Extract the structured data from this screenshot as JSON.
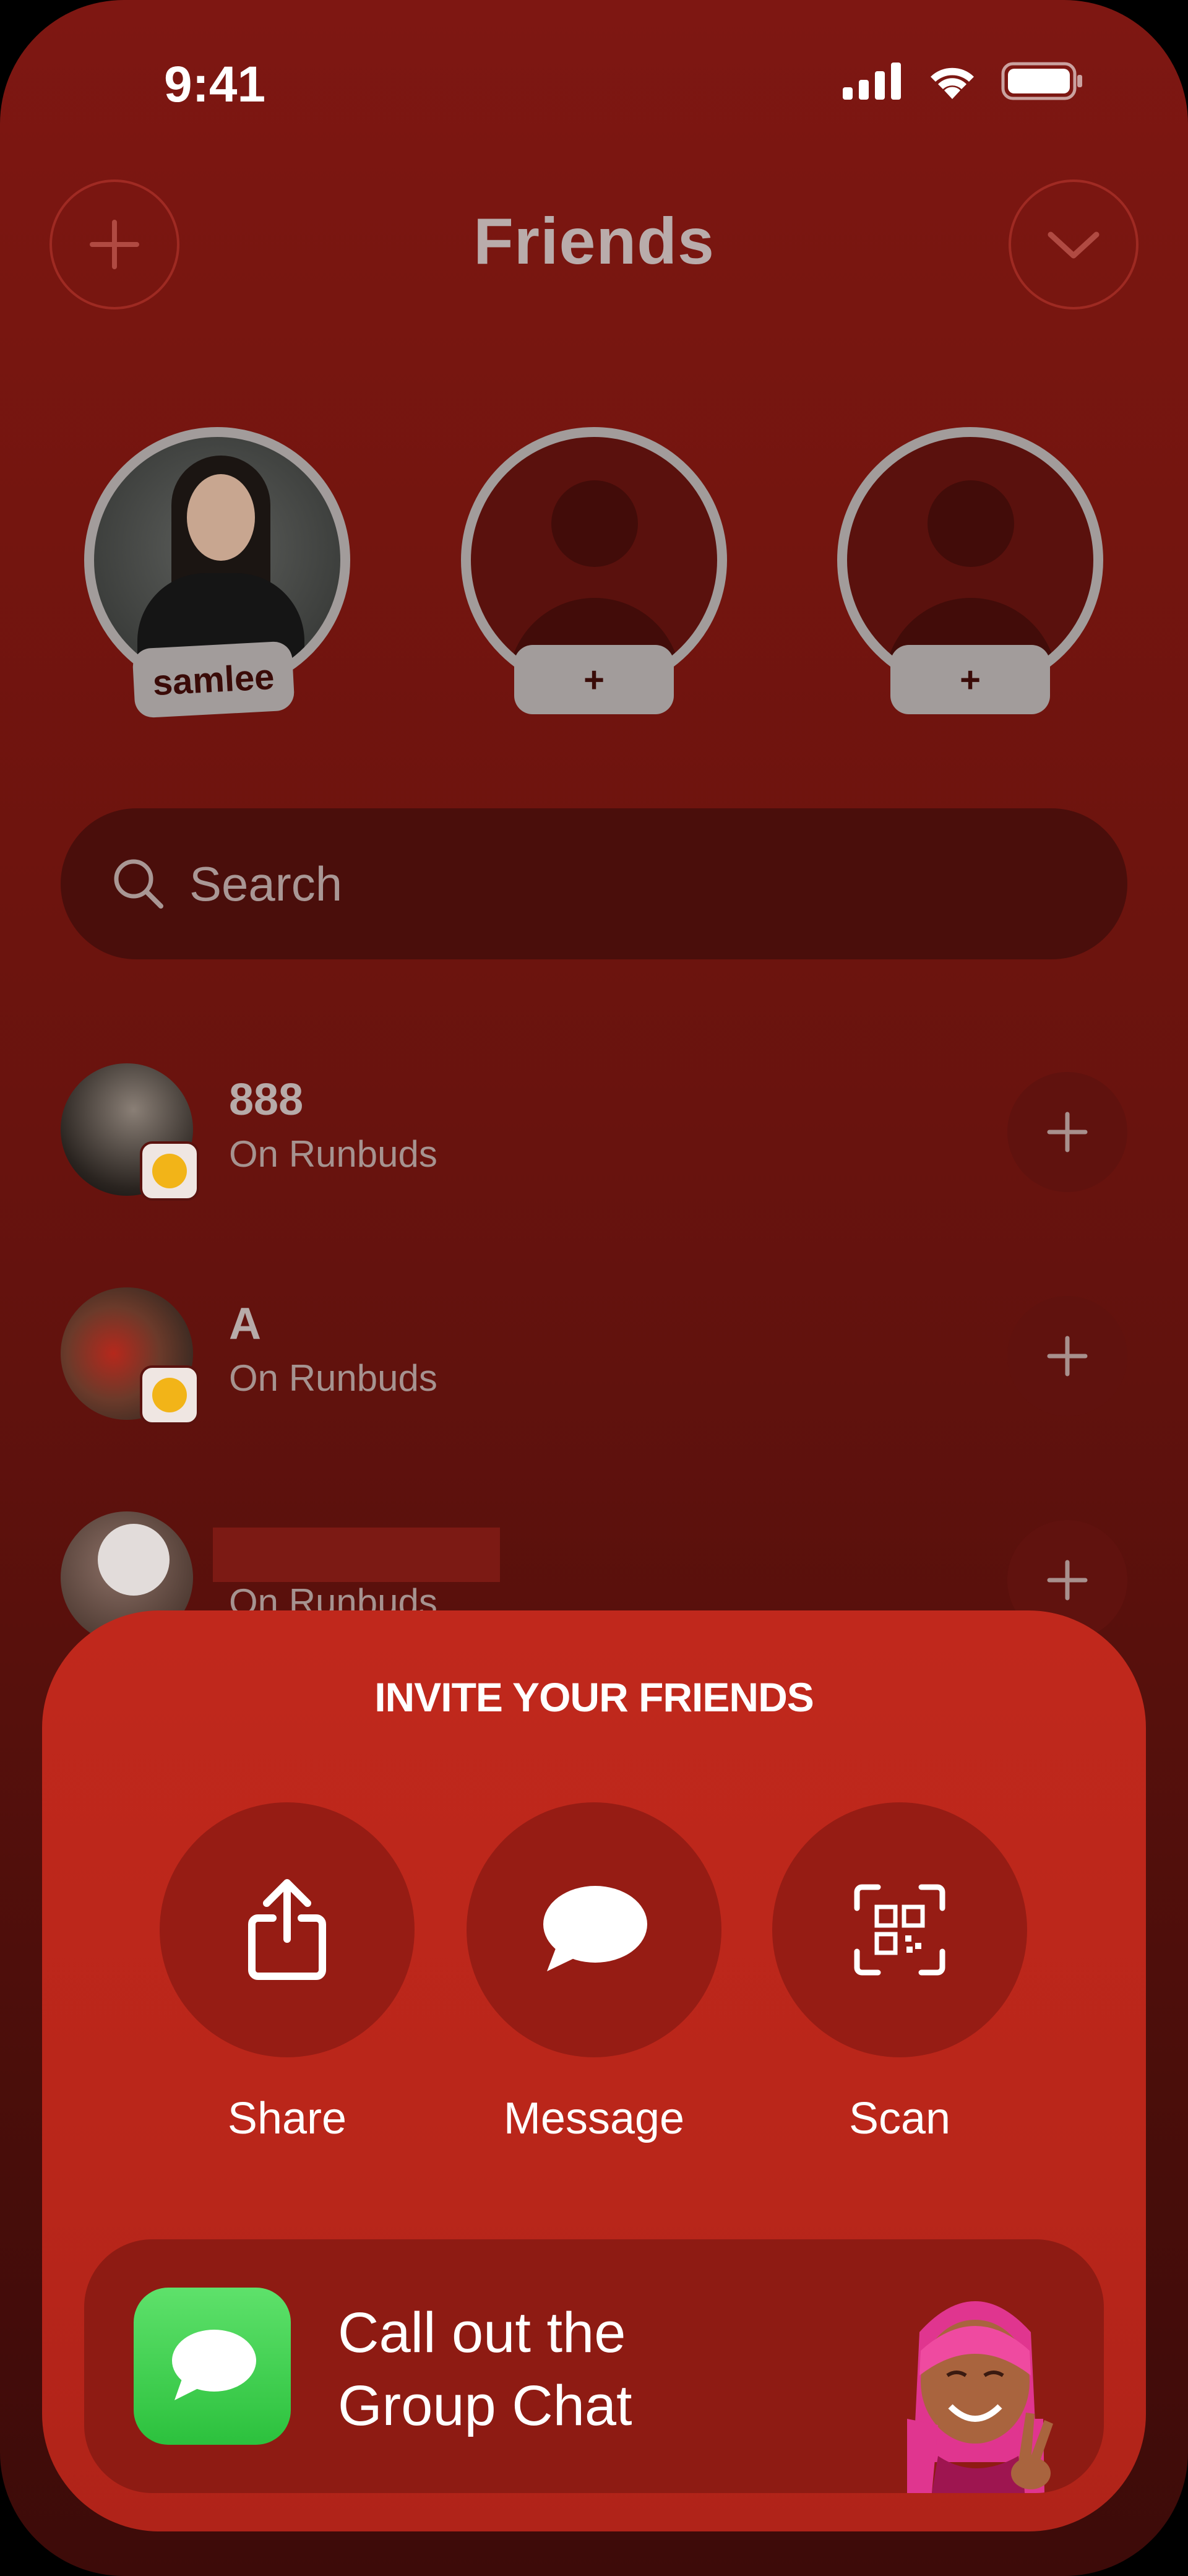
{
  "status_bar": {
    "time": "9:41"
  },
  "header": {
    "title": "Friends"
  },
  "stories": [
    {
      "label": "samlee"
    },
    {
      "label": "+"
    },
    {
      "label": "+"
    }
  ],
  "search": {
    "placeholder": "Search"
  },
  "friends": [
    {
      "name": "888",
      "status": "On Runbuds"
    },
    {
      "name": "A",
      "status": "On Runbuds"
    },
    {
      "name": "",
      "status": "On Runbuds"
    }
  ],
  "invite": {
    "title": "INVITE YOUR FRIENDS",
    "actions": [
      {
        "label": "Share",
        "icon": "share-icon"
      },
      {
        "label": "Message",
        "icon": "message-bubble-icon"
      },
      {
        "label": "Scan",
        "icon": "qr-scan-icon"
      }
    ],
    "promo": {
      "line1": "Call out the",
      "line2": "Group Chat"
    }
  },
  "colors": {
    "background": "#7e1712",
    "sheet": "#c0281c",
    "promo_card": "#8e1b13",
    "messages_green": "#34c759"
  }
}
